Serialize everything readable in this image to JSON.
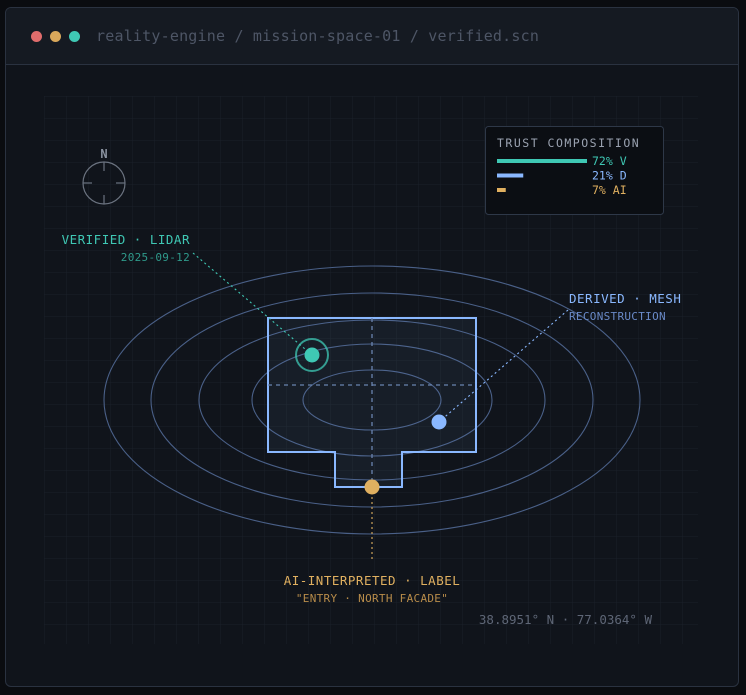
{
  "window": {
    "path": "reality-engine / mission-space-01 / verified.scn"
  },
  "compass": {
    "label": "N"
  },
  "trust": {
    "title": "TRUST COMPOSITION",
    "rows": [
      {
        "label": "72% V",
        "fraction": 0.72,
        "color": "#3fc8b4"
      },
      {
        "label": "21% D",
        "fraction": 0.21,
        "color": "#8ab8ff"
      },
      {
        "label": "7% AI",
        "fraction": 0.07,
        "color": "#e0b060"
      }
    ]
  },
  "callouts": {
    "verified": {
      "title": "VERIFIED · LIDAR",
      "sub": "2025-09-12",
      "color": "#3fc8b4"
    },
    "derived": {
      "title": "DERIVED · MESH",
      "sub": "RECONSTRUCTION",
      "color": "#8ab8ff"
    },
    "ai": {
      "title": "AI-INTERPRETED · LABEL",
      "sub": "\"ENTRY · NORTH FACADE\"",
      "color": "#e0b060"
    }
  },
  "coordinates": "38.8951° N · 77.0364° W"
}
